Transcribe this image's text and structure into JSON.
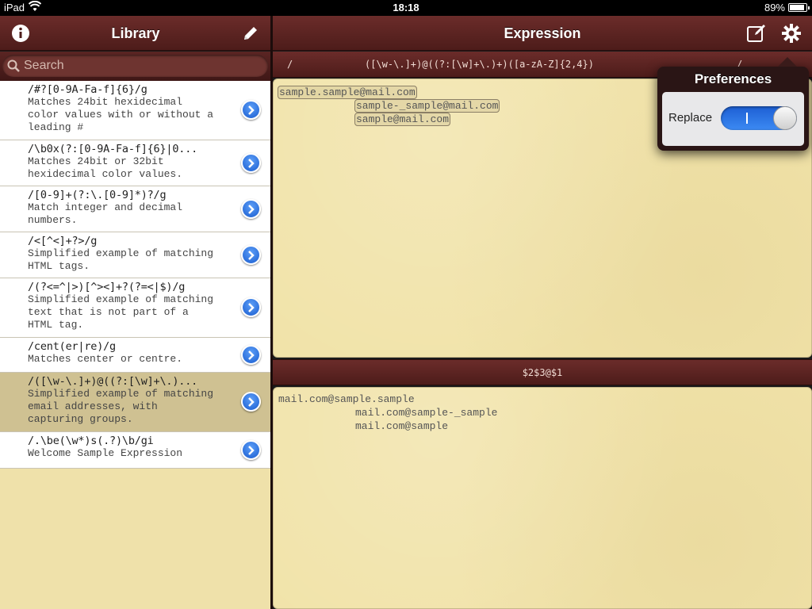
{
  "status": {
    "carrier": "iPad",
    "time": "18:18",
    "battery": "89%"
  },
  "library": {
    "title": "Library",
    "search_placeholder": "Search",
    "items": [
      {
        "expr": "/#?[0-9A-Fa-f]{6}/g",
        "desc": [
          "Matches 24bit hexidecimal",
          "color values with or without a",
          "leading #"
        ]
      },
      {
        "expr": "/\\b0x(?:[0-9A-Fa-f]{6}|0...",
        "desc": [
          "Matches 24bit or 32bit",
          "hexidecimal color values."
        ]
      },
      {
        "expr": "/[0-9]+(?:\\.[0-9]*)?/g",
        "desc": [
          "Match integer and decimal",
          "numbers."
        ]
      },
      {
        "expr": "/<[^<]+?>/g",
        "desc": [
          "Simplified example of matching",
          "HTML tags."
        ]
      },
      {
        "expr": "/(?<=^|>)[^><]+?(?=<|$)/g",
        "desc": [
          "Simplified example of matching",
          "text that is not part of a",
          "HTML tag."
        ]
      },
      {
        "expr": "/cent(er|re)/g",
        "desc": [
          "Matches center or centre."
        ]
      },
      {
        "expr": "/([\\w-\\.]+)@((?:[\\w]+\\.)...",
        "desc": [
          "Simplified example of matching",
          "email addresses, with",
          "capturing groups."
        ]
      },
      {
        "expr": "/.\\be(\\w*)s(.?)\\b/gi",
        "desc": [
          "Welcome Sample Expression"
        ]
      }
    ]
  },
  "expression": {
    "title": "Expression",
    "slash_open": "/",
    "pattern": "([\\w-\\.]+)@((?:[\\w]+\\.)+)([a-zA-Z]{2,4})",
    "slash_close": "/",
    "matches": [
      "sample.sample@mail.com",
      "sample-_sample@mail.com",
      "sample@mail.com"
    ],
    "replacement": "$2$3@$1",
    "results": [
      "mail.com@sample.sample",
      "mail.com@sample-_sample",
      "mail.com@sample"
    ]
  },
  "preferences": {
    "title": "Preferences",
    "replace_label": "Replace",
    "replace_on": true
  }
}
